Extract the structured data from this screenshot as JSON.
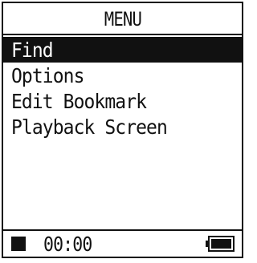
{
  "header": {
    "title": "MENU"
  },
  "menu": {
    "items": [
      {
        "label": "Find",
        "selected": true
      },
      {
        "label": "Options",
        "selected": false
      },
      {
        "label": "Edit Bookmark",
        "selected": false
      },
      {
        "label": "Playback Screen",
        "selected": false
      }
    ]
  },
  "status": {
    "stop_icon": "stop-icon",
    "time": "00:00",
    "battery_icon": "battery-icon",
    "battery_level": 1
  },
  "colors": {
    "foreground": "#111111",
    "background": "#ffffff",
    "selected_text": "#ffffff"
  }
}
